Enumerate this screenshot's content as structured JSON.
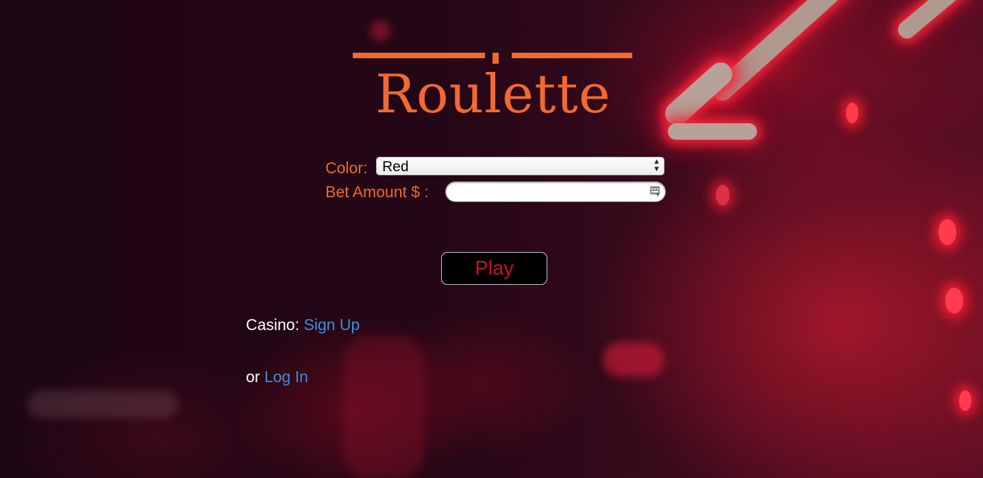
{
  "page": {
    "title": "Roulette",
    "accent_color": "#f06a32",
    "link_color": "#3d8ee0",
    "play_text_color": "#c8102e"
  },
  "form": {
    "color_label": "Color:",
    "color_selected": "Red",
    "bet_label": "Bet Amount $ :",
    "bet_value": "",
    "play_label": "Play"
  },
  "auth": {
    "casino_prefix": "Casino:",
    "signup_label": "Sign Up",
    "or_prefix": "or",
    "login_label": "Log In"
  },
  "icons": {
    "select_arrows": "up-down-arrows",
    "keypad": "keypad-icon"
  }
}
